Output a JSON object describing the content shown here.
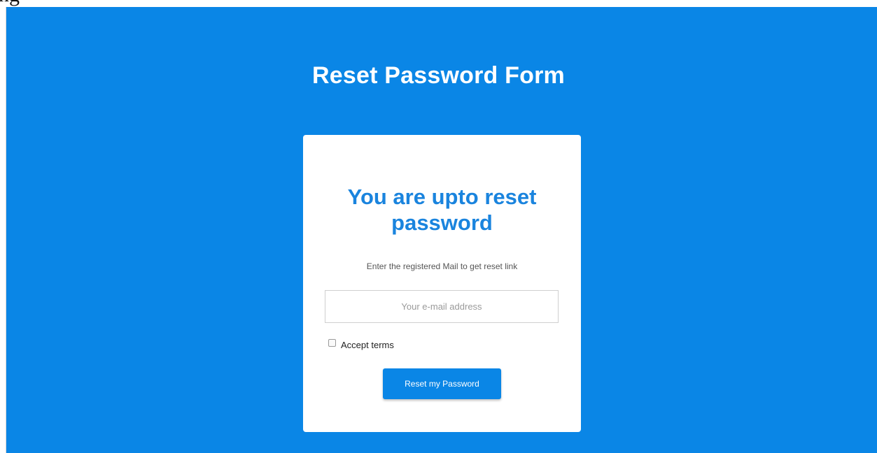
{
  "document": {
    "fragment_text": "ng"
  },
  "page": {
    "title": "Reset Password Form",
    "background_color": "#0a86e6"
  },
  "card": {
    "heading": "You are upto reset password",
    "subtitle": "Enter the registered Mail to get reset link",
    "email_placeholder": "Your e-mail address",
    "email_value": "",
    "terms_label": "Accept terms",
    "terms_checked": false,
    "reset_button_label": "Reset my Password",
    "accent_color": "#1a84de"
  }
}
